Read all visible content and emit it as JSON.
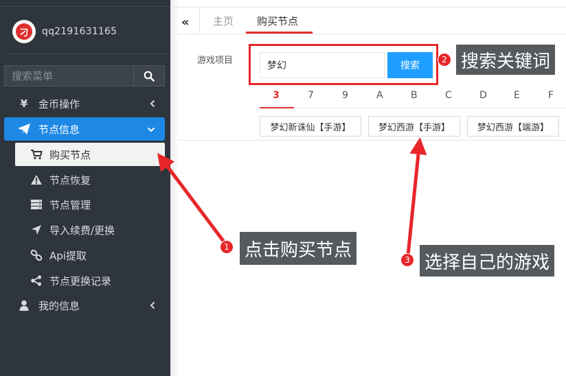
{
  "sidebar": {
    "username": "qq2191631165",
    "avatar_glyph": "刁",
    "search_placeholder": "搜索菜单",
    "menu": {
      "coin_ops": "金币操作",
      "node_info": "节点信息",
      "my_info": "我的信息"
    },
    "submenu": {
      "buy_node": "购买节点",
      "node_restore": "节点恢复",
      "node_manage": "节点管理",
      "import_renew": "导入续费/更换",
      "api_fetch": "Api提取",
      "node_change_log": "节点更换记录"
    }
  },
  "tabs": {
    "collapse": "«",
    "home": "主页",
    "buy": "购买节点"
  },
  "form": {
    "label": "游戏项目",
    "keyword_value": "梦幻",
    "search_button": "搜索"
  },
  "letters": [
    "3",
    "7",
    "9",
    "A",
    "B",
    "C",
    "D",
    "E",
    "F"
  ],
  "games": [
    "梦幻新诛仙【手游】",
    "梦幻西游【手游】",
    "梦幻西游【端游】"
  ],
  "annotations": {
    "step1": {
      "num": "1",
      "text": "点击购买节点"
    },
    "step2": {
      "num": "2",
      "text": "搜索关键词"
    },
    "step3": {
      "num": "3",
      "text": "选择自己的游戏"
    }
  },
  "colors": {
    "sidebar_bg": "#2f353c",
    "active_blue": "#1e88e5",
    "button_blue": "#1e9fff",
    "accent_red": "#e02d2d",
    "annotation_bg": "#555a5f"
  }
}
